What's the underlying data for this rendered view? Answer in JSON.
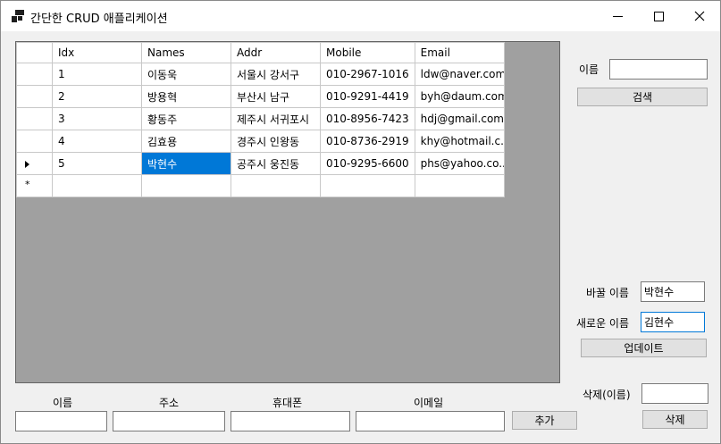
{
  "window": {
    "title": "간단한 CRUD 애플리케이션",
    "controls": {
      "minimize": "minimize-icon",
      "maximize": "maximize-icon",
      "close": "close-icon"
    }
  },
  "grid": {
    "columns": [
      "Idx",
      "Names",
      "Addr",
      "Mobile",
      "Email"
    ],
    "rows": [
      [
        "1",
        "이동욱",
        "서울시 강서구",
        "010-2967-1016",
        "ldw@naver.com"
      ],
      [
        "2",
        "방용혁",
        "부산시 남구",
        "010-9291-4419",
        "byh@daum.com"
      ],
      [
        "3",
        "황동주",
        "제주시 서귀포시",
        "010-8956-7423",
        "hdj@gmail.com"
      ],
      [
        "4",
        "김효용",
        "경주시 인왕동",
        "010-8736-2919",
        "khy@hotmail.c..."
      ],
      [
        "5",
        "박현수",
        "공주시 웅진동",
        "010-9295-6600",
        "phs@yahoo.co...."
      ]
    ],
    "current_row_index": 4,
    "selected_cell": "Names",
    "new_row_marker": "*"
  },
  "search": {
    "label": "이름",
    "value": "",
    "button": "검색"
  },
  "update": {
    "old_name_label": "바꿀 이름",
    "old_name_value": "박현수",
    "new_name_label": "새로운 이름",
    "new_name_value": "김현수",
    "button": "업데이트"
  },
  "delete": {
    "label": "삭제(이름)",
    "value": "",
    "button": "삭제"
  },
  "add": {
    "name_label": "이름",
    "addr_label": "주소",
    "phone_label": "휴대폰",
    "email_label": "이메일",
    "name_value": "",
    "addr_value": "",
    "phone_value": "",
    "email_value": "",
    "button": "추가"
  }
}
